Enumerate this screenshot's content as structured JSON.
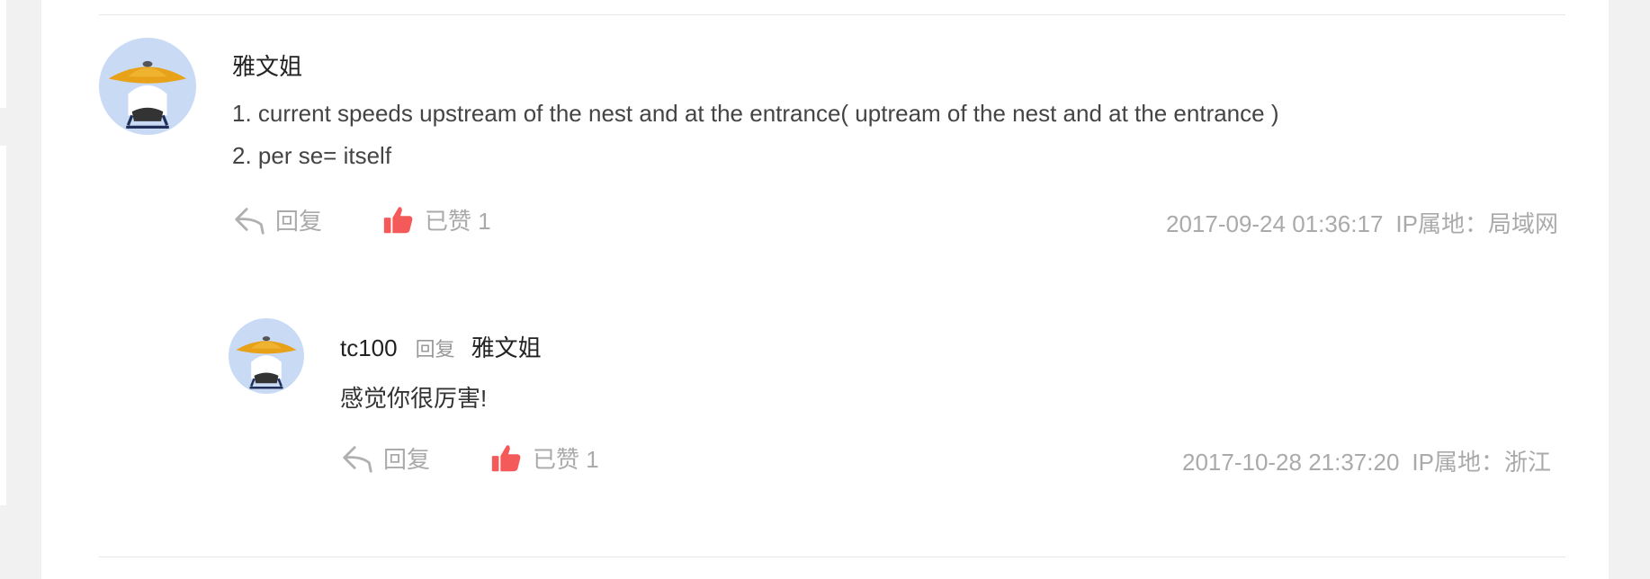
{
  "comment": {
    "username": "雅文姐",
    "lines": [
      "1. current speeds upstream of the nest and at the entrance( uptream of the nest and at the entrance )",
      "2. per se= itself"
    ],
    "reply_label": "回复",
    "like_label": "已赞 1",
    "timestamp": "2017-09-24 01:36:17",
    "ip_location": "IP属地：局域网",
    "avatar_icon": "straw-hat-avatar-icon"
  },
  "reply": {
    "username": "tc100",
    "reply_word": "回复",
    "reply_to": "雅文姐",
    "text": "感觉你很厉害!",
    "reply_label": "回复",
    "like_label": "已赞 1",
    "timestamp": "2017-10-28 21:37:20",
    "ip_location": "IP属地：浙江",
    "avatar_icon": "straw-hat-avatar-icon"
  },
  "colors": {
    "background": "#f1f1f1",
    "panel": "#ffffff",
    "muted_text": "#aaaaaa",
    "like_icon": "#f45a5a",
    "avatar_bg": "#c9daf5",
    "hat": "#e8a21a"
  }
}
